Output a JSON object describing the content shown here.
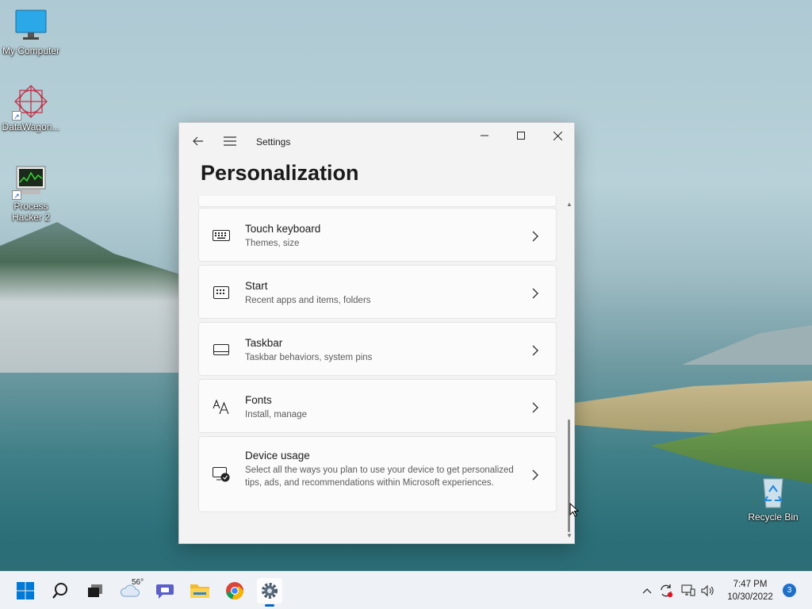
{
  "desktop": {
    "icons": [
      {
        "label": "My Computer",
        "icon": "monitor-icon"
      },
      {
        "label": "DataWagon...",
        "icon": "datawagon-icon"
      },
      {
        "label": "Process Hacker 2",
        "icon": "process-hacker-icon"
      },
      {
        "label": "Recycle Bin",
        "icon": "recycle-bin-icon"
      }
    ]
  },
  "window": {
    "app_title": "Settings",
    "page_title": "Personalization",
    "items": [
      {
        "label": "Touch keyboard",
        "desc": "Themes, size",
        "icon": "keyboard-icon"
      },
      {
        "label": "Start",
        "desc": "Recent apps and items, folders",
        "icon": "start-icon"
      },
      {
        "label": "Taskbar",
        "desc": "Taskbar behaviors, system pins",
        "icon": "taskbar-icon"
      },
      {
        "label": "Fonts",
        "desc": "Install, manage",
        "icon": "fonts-icon"
      },
      {
        "label": "Device usage",
        "desc": "Select all the ways you plan to use your device to get personalized tips, ads, and recommendations within Microsoft experiences.",
        "icon": "device-usage-icon"
      }
    ]
  },
  "taskbar": {
    "weather_temp": "56°",
    "clock_time": "7:47 PM",
    "clock_date": "10/30/2022",
    "notification_count": "3"
  },
  "colors": {
    "accent": "#0067c0",
    "window_bg": "#f3f3f3",
    "card_bg": "#fbfbfb"
  }
}
